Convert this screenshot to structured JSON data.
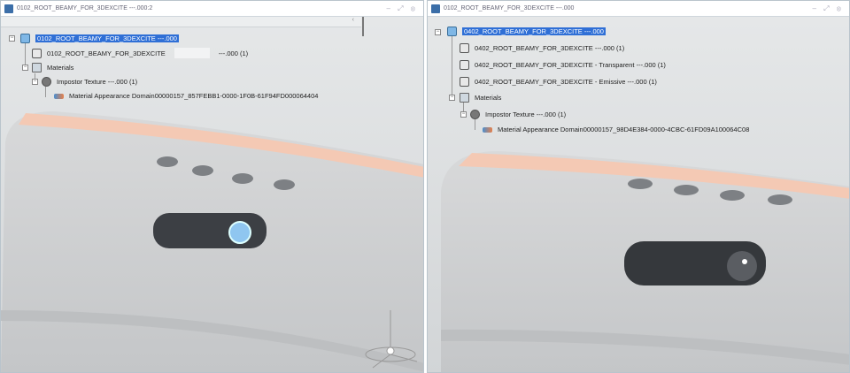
{
  "left_pane": {
    "title": "0102_ROOT_BEAMY_FOR_3DEXCITE ---.000:2",
    "window_controls": "– ⤢ ⊗",
    "strip_chevron": "‹",
    "tree": [
      {
        "label": "0102_ROOT_BEAMY_FOR_3DEXCITE ---.000",
        "icon": "product-icon",
        "selected": true
      },
      {
        "label": "0102_ROOT_BEAMY_FOR_3DEXCITE",
        "suffix": "---.000 (1)",
        "icon": "part-icon"
      },
      {
        "label": "Materials",
        "icon": "folder-icon"
      },
      {
        "label": "Impostor Texture ---.000 (1)",
        "icon": "texture-icon"
      },
      {
        "label": "Material Appearance Domain00000157_857FEBB1-0000-1F0B-61F94FD000064404",
        "icon": "material-icon"
      }
    ]
  },
  "right_pane": {
    "title": "0102_ROOT_BEAMY_FOR_3DEXCITE ---.000",
    "window_controls": "– ⤢ ⊗",
    "tree": [
      {
        "label": "0402_ROOT_BEAMY_FOR_3DEXCITE ---.000",
        "icon": "product-icon",
        "selected": true
      },
      {
        "label": "0402_ROOT_BEAMY_FOR_3DEXCITE ---.000 (1)",
        "icon": "part-icon"
      },
      {
        "label": "0402_ROOT_BEAMY_FOR_3DEXCITE - Transparent ---.000 (1)",
        "icon": "part-icon"
      },
      {
        "label": "0402_ROOT_BEAMY_FOR_3DEXCITE - Emissive ---.000 (1)",
        "icon": "part-icon"
      },
      {
        "label": "Materials",
        "icon": "folder-icon"
      },
      {
        "label": "Impostor Texture ---.000 (1)",
        "icon": "texture-icon"
      },
      {
        "label": "Material Appearance Domain00000157_98D4E384-0000-4CBC-61FD09A100064C08",
        "icon": "material-icon"
      }
    ]
  },
  "colors": {
    "selection": "#2f6fd6",
    "rim": "#f4c9b4",
    "fabric": "#cfd1d3"
  }
}
